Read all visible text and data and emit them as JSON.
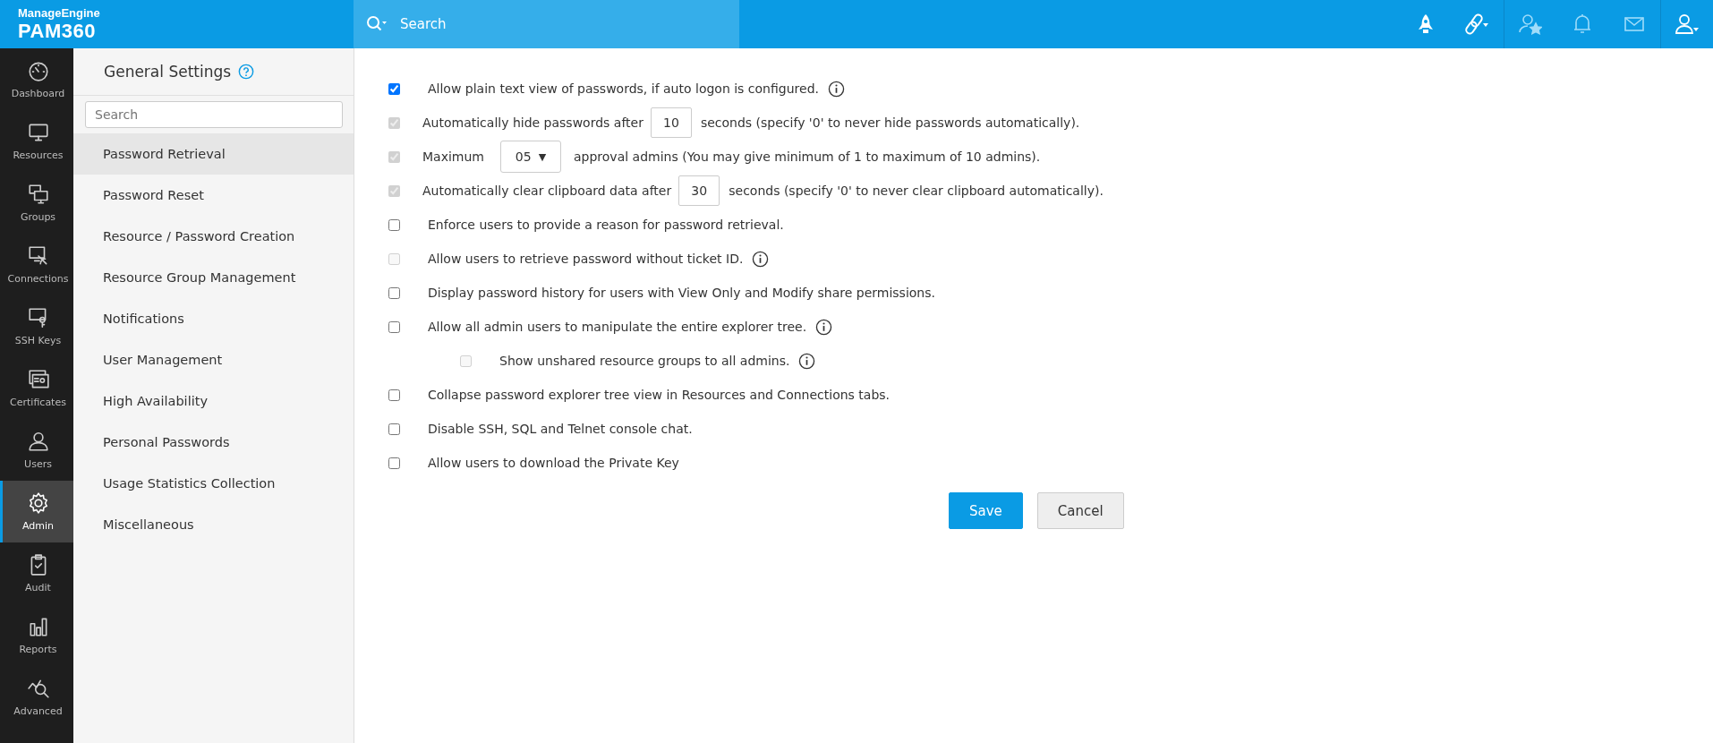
{
  "header": {
    "brand": "ManageEngine",
    "product": "PAM360",
    "search": {
      "placeholder": "Search"
    }
  },
  "nav": [
    {
      "label": "Dashboard",
      "selected": false
    },
    {
      "label": "Resources",
      "selected": false
    },
    {
      "label": "Groups",
      "selected": false
    },
    {
      "label": "Connections",
      "selected": false
    },
    {
      "label": "SSH Keys",
      "selected": false
    },
    {
      "label": "Certificates",
      "selected": false
    },
    {
      "label": "Users",
      "selected": false
    },
    {
      "label": "Admin",
      "selected": true
    },
    {
      "label": "Audit",
      "selected": false
    },
    {
      "label": "Reports",
      "selected": false
    },
    {
      "label": "Advanced",
      "selected": false
    }
  ],
  "settings": {
    "title": "General Settings",
    "search": {
      "placeholder": "Search"
    },
    "items": [
      {
        "label": "Password Retrieval",
        "selected": true
      },
      {
        "label": "Password Reset",
        "selected": false
      },
      {
        "label": "Resource / Password Creation",
        "selected": false
      },
      {
        "label": "Resource Group Management",
        "selected": false
      },
      {
        "label": "Notifications",
        "selected": false
      },
      {
        "label": "User Management",
        "selected": false
      },
      {
        "label": "High Availability",
        "selected": false
      },
      {
        "label": "Personal Passwords",
        "selected": false
      },
      {
        "label": "Usage Statistics Collection",
        "selected": false
      },
      {
        "label": "Miscellaneous",
        "selected": false
      }
    ]
  },
  "options": [
    {
      "kind": "text",
      "checked": true,
      "disabled": false,
      "label": "Allow plain text view of passwords, if auto logon is configured.",
      "info": true
    },
    {
      "kind": "number",
      "checked": true,
      "disabled": true,
      "before": "Automatically hide passwords after",
      "value": "10",
      "after": "seconds (specify '0' to never hide passwords automatically)."
    },
    {
      "kind": "select",
      "checked": true,
      "disabled": true,
      "before": "Maximum",
      "value": "05",
      "caret": "▼",
      "after": "approval admins (You may give minimum of 1 to maximum of 10 admins)."
    },
    {
      "kind": "number",
      "checked": true,
      "disabled": true,
      "before": "Automatically clear clipboard data after",
      "value": "30",
      "after": "seconds (specify '0' to never clear clipboard automatically)."
    },
    {
      "kind": "text",
      "checked": false,
      "disabled": false,
      "label": "Enforce users to provide a reason for password retrieval.",
      "info": false
    },
    {
      "kind": "text",
      "checked": false,
      "disabled": true,
      "label": "Allow users to retrieve password without ticket ID.",
      "info": true
    },
    {
      "kind": "text",
      "checked": false,
      "disabled": false,
      "label": "Display password history for users with View Only and Modify share permissions.",
      "info": false
    },
    {
      "kind": "text",
      "checked": false,
      "disabled": false,
      "label": "Allow all admin users to manipulate the entire explorer tree.",
      "info": true,
      "children": [
        {
          "kind": "text",
          "checked": false,
          "disabled": true,
          "label": "Show unshared resource groups to all admins.",
          "info": true
        }
      ]
    },
    {
      "kind": "text",
      "checked": false,
      "disabled": false,
      "label": "Collapse password explorer tree view in Resources and Connections tabs.",
      "info": false
    },
    {
      "kind": "text",
      "checked": false,
      "disabled": false,
      "label": "Disable SSH, SQL and Telnet console chat.",
      "info": false
    },
    {
      "kind": "text",
      "checked": false,
      "disabled": false,
      "label": "Allow users to download the Private Key",
      "info": false
    }
  ],
  "buttons": [
    {
      "label": "Save",
      "kind": "primary"
    },
    {
      "label": "Cancel",
      "kind": "secondary"
    }
  ]
}
